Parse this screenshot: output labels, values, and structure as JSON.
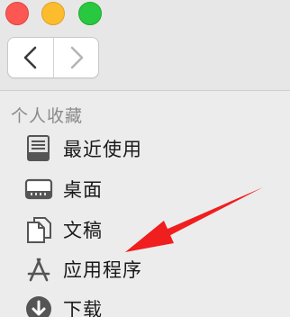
{
  "window": {
    "traffic_lights": [
      "close-button",
      "minimize-button",
      "zoom-button"
    ]
  },
  "toolbar": {
    "back_icon": "chevron-left-icon",
    "forward_icon": "chevron-right-icon"
  },
  "sidebar": {
    "section_title": "个人收藏",
    "items": [
      {
        "label": "最近使用",
        "icon": "recents-icon"
      },
      {
        "label": "桌面",
        "icon": "desktop-icon"
      },
      {
        "label": "文稿",
        "icon": "documents-icon"
      },
      {
        "label": "应用程序",
        "icon": "applications-icon"
      },
      {
        "label": "下载",
        "icon": "downloads-icon"
      }
    ]
  },
  "annotation": {
    "color": "#f01e1e",
    "points_to": "应用程序"
  }
}
